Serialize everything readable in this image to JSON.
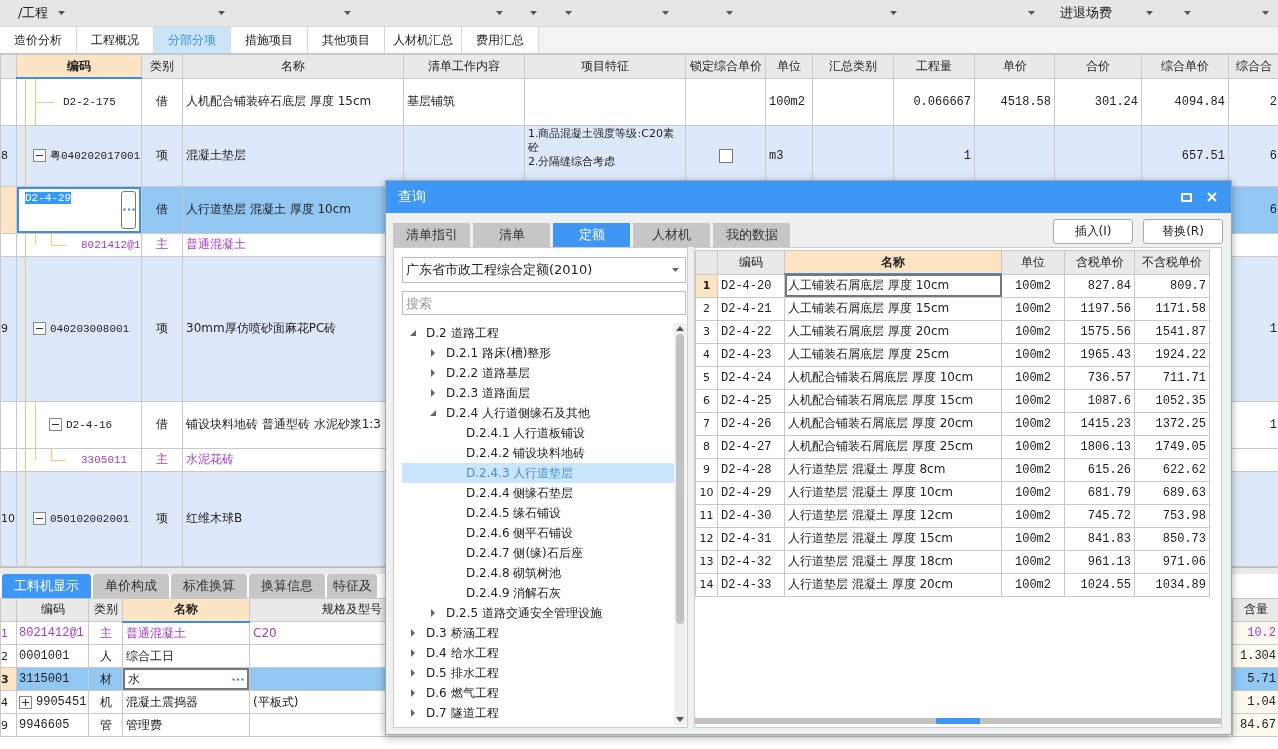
{
  "toolbar": {
    "items": [
      {
        "label": "/工程"
      },
      {
        "label": "进退场费"
      }
    ]
  },
  "tabs": [
    {
      "label": "造价分析",
      "selected": false
    },
    {
      "label": "工程概况",
      "selected": false
    },
    {
      "label": "分部分项",
      "selected": true
    },
    {
      "label": "措施项目",
      "selected": false
    },
    {
      "label": "其他项目",
      "selected": false
    },
    {
      "label": "人材机汇总",
      "selected": false
    },
    {
      "label": "费用汇总",
      "selected": false
    }
  ],
  "grid": {
    "columns": [
      {
        "label": "编码",
        "selected": true
      },
      {
        "label": "类别",
        "selected": false
      },
      {
        "label": "名称",
        "selected": false
      },
      {
        "label": "清单工作内容",
        "selected": false
      },
      {
        "label": "项目特征",
        "selected": false
      },
      {
        "label": "锁定综合单价",
        "selected": false
      },
      {
        "label": "单位",
        "selected": false
      },
      {
        "label": "汇总类别",
        "selected": false
      },
      {
        "label": "工程量",
        "selected": false
      },
      {
        "label": "单价",
        "selected": false
      },
      {
        "label": "合价",
        "selected": false
      },
      {
        "label": "综合单价",
        "selected": false
      },
      {
        "label": "综合合",
        "selected": false
      }
    ],
    "rows": [
      {
        "kind": "quota",
        "code": "D2-2-175",
        "type": "借",
        "name": "人机配合铺装碎石底层 厚度 15cm",
        "work": "基层铺筑",
        "unit": "100m2",
        "qty": "0.066667",
        "price": "4518.58",
        "total": "301.24",
        "unit_price": "4094.84",
        "col_14": "2",
        "selected": false,
        "editing": false
      },
      {
        "kind": "list",
        "num": "8",
        "code": "粤040202017001",
        "type": "项",
        "name": "混凝土垫层",
        "features": [
          "1.商品混凝土强度等级:C20素砼",
          "2.分隔缝综合考虑"
        ],
        "lock_checked": false,
        "unit": "m3",
        "qty": "1",
        "unit_price": "657.51",
        "col_14": "6",
        "selected": false,
        "editing": false,
        "expanded": true,
        "children": [
          {
            "kind": "quota",
            "code": "D2-4-29",
            "type": "借",
            "name": "人行道垫层 混凝土 厚度 10cm",
            "col_14": "6",
            "selected": true,
            "editing": true,
            "children": [
              {
                "kind": "material",
                "code": "8021412@1",
                "type": "主",
                "name": "普通混凝土",
                "selected": false,
                "editing": false
              }
            ]
          }
        ]
      },
      {
        "kind": "list",
        "num": "9",
        "code": "040203008001",
        "type": "项",
        "name": "30mm厚仿喷砂面麻花PC砖",
        "col_14": "1",
        "selected": false,
        "editing": false,
        "expanded": true,
        "children": [
          {
            "kind": "quota",
            "code": "D2-4-16",
            "type": "借",
            "name": "铺设块料地砖 普通型砖 水泥砂浆1:3",
            "col_14": "1",
            "selected": false,
            "editing": false,
            "expanded": true,
            "children": [
              {
                "kind": "material",
                "code": "3305011",
                "type": "主",
                "name": "水泥花砖",
                "selected": false,
                "editing": false
              }
            ]
          }
        ]
      },
      {
        "kind": "list",
        "num": "10",
        "code": "050102002001",
        "type": "项",
        "name": "红维木球B",
        "selected": false,
        "editing": false,
        "expanded": true
      }
    ]
  },
  "detail_tabs": [
    {
      "label": "工料机显示",
      "selected": true
    },
    {
      "label": "单价构成",
      "selected": false
    },
    {
      "label": "标准换算",
      "selected": false
    },
    {
      "label": "换算信息",
      "selected": false
    },
    {
      "label": "特征及",
      "selected": false
    }
  ],
  "detail_table": {
    "columns": [
      {
        "label": "编码",
        "selected": false
      },
      {
        "label": "类别",
        "selected": false
      },
      {
        "label": "名称",
        "selected": true
      },
      {
        "label": "规格及型号",
        "selected": false
      },
      {
        "label": "含量",
        "selected": false
      }
    ],
    "rows": [
      {
        "num": "1",
        "kind": "material",
        "code": "8021412@1",
        "type": "主",
        "name": "普通混凝土",
        "spec": "C20",
        "amount": "10.2",
        "selected": false,
        "editing": false
      },
      {
        "num": "2",
        "kind": "labor",
        "code": "0001001",
        "type": "人",
        "name": "综合工日",
        "amount": "1.304",
        "selected": false,
        "editing": false
      },
      {
        "num": "3",
        "kind": "labor",
        "code": "3115001",
        "type": "材",
        "name": "水",
        "amount": "5.71",
        "selected": true,
        "editing": true
      },
      {
        "num": "4",
        "kind": "labor",
        "code": "9905451",
        "type": "机",
        "name": "混凝土震捣器",
        "spec": "(平板式)",
        "amount": "1.04",
        "selected": false,
        "editing": false,
        "expanded": false
      },
      {
        "num": "9",
        "kind": "labor",
        "code": "9946605",
        "type": "管",
        "name": "管理费",
        "amount": "84.67",
        "selected": false,
        "editing": false
      }
    ]
  },
  "dialog": {
    "title": "查询",
    "tabs": [
      {
        "label": "清单指引",
        "selected": false
      },
      {
        "label": "清单",
        "selected": false
      },
      {
        "label": "定额",
        "selected": true
      },
      {
        "label": "人材机",
        "selected": false
      },
      {
        "label": "我的数据",
        "selected": false
      }
    ],
    "buttons": [
      "插入(I)",
      "替换(R)"
    ],
    "library": "广东省市政工程综合定额(2010)",
    "search_placeholder": "搜索",
    "tree": [
      {
        "label": "D.2 道路工程",
        "expanded": true,
        "selected": false,
        "children": [
          {
            "label": "D.2.1 路床(槽)整形",
            "expanded": false,
            "selected": false
          },
          {
            "label": "D.2.2 道路基层",
            "expanded": false,
            "selected": false
          },
          {
            "label": "D.2.3 道路面层",
            "expanded": false,
            "selected": false
          },
          {
            "label": "D.2.4 人行道侧缘石及其他",
            "expanded": true,
            "selected": false,
            "children": [
              {
                "label": "D.2.4.1 人行道板铺设",
                "selected": false
              },
              {
                "label": "D.2.4.2 铺设块料地砖",
                "selected": false
              },
              {
                "label": "D.2.4.3 人行道垫层",
                "selected": true
              },
              {
                "label": "D.2.4.4 侧缘石垫层",
                "selected": false
              },
              {
                "label": "D.2.4.5 缘石铺设",
                "selected": false
              },
              {
                "label": "D.2.4.6 侧平石铺设",
                "selected": false
              },
              {
                "label": "D.2.4.7 侧(缘)石后座",
                "selected": false
              },
              {
                "label": "D.2.4.8 砌筑树池",
                "selected": false
              },
              {
                "label": "D.2.4.9 消解石灰",
                "selected": false
              }
            ]
          },
          {
            "label": "D.2.5 道路交通安全管理设施",
            "expanded": false,
            "selected": false
          }
        ]
      },
      {
        "label": "D.3 桥涵工程",
        "expanded": false,
        "selected": false
      },
      {
        "label": "D.4 给水工程",
        "expanded": false,
        "selected": false
      },
      {
        "label": "D.5 排水工程",
        "expanded": false,
        "selected": false
      },
      {
        "label": "D.6 燃气工程",
        "expanded": false,
        "selected": false
      },
      {
        "label": "D.7 隧道工程",
        "expanded": false,
        "selected": false
      }
    ],
    "table": {
      "columns": [
        {
          "label": "编码",
          "selected": false
        },
        {
          "label": "名称",
          "selected": true
        },
        {
          "label": "单位",
          "selected": false
        },
        {
          "label": "含税单价",
          "selected": false
        },
        {
          "label": "不含税单价",
          "selected": false
        }
      ],
      "rows": [
        {
          "num": "1",
          "code": "D2-4-20",
          "name": "人工铺装石屑底层 厚度 10cm",
          "unit": "100m2",
          "price_tax": "827.84",
          "price_notax": "809.7",
          "selected": true
        },
        {
          "num": "2",
          "code": "D2-4-21",
          "name": "人工铺装石屑底层 厚度 15cm",
          "unit": "100m2",
          "price_tax": "1197.56",
          "price_notax": "1171.58",
          "selected": false
        },
        {
          "num": "3",
          "code": "D2-4-22",
          "name": "人工铺装石屑底层 厚度 20cm",
          "unit": "100m2",
          "price_tax": "1575.56",
          "price_notax": "1541.87",
          "selected": false
        },
        {
          "num": "4",
          "code": "D2-4-23",
          "name": "人工铺装石屑底层 厚度 25cm",
          "unit": "100m2",
          "price_tax": "1965.43",
          "price_notax": "1924.22",
          "selected": false
        },
        {
          "num": "5",
          "code": "D2-4-24",
          "name": "人机配合铺装石屑底层 厚度 10cm",
          "unit": "100m2",
          "price_tax": "736.57",
          "price_notax": "711.71",
          "selected": false
        },
        {
          "num": "6",
          "code": "D2-4-25",
          "name": "人机配合铺装石屑底层 厚度 15cm",
          "unit": "100m2",
          "price_tax": "1087.6",
          "price_notax": "1052.35",
          "selected": false
        },
        {
          "num": "7",
          "code": "D2-4-26",
          "name": "人机配合铺装石屑底层 厚度 20cm",
          "unit": "100m2",
          "price_tax": "1415.23",
          "price_notax": "1372.25",
          "selected": false
        },
        {
          "num": "8",
          "code": "D2-4-27",
          "name": "人机配合铺装石屑底层 厚度 25cm",
          "unit": "100m2",
          "price_tax": "1806.13",
          "price_notax": "1749.05",
          "selected": false
        },
        {
          "num": "9",
          "code": "D2-4-28",
          "name": "人行道垫层 混凝土 厚度 8cm",
          "unit": "100m2",
          "price_tax": "615.26",
          "price_notax": "622.62",
          "selected": false
        },
        {
          "num": "10",
          "code": "D2-4-29",
          "name": "人行道垫层 混凝土 厚度 10cm",
          "unit": "100m2",
          "price_tax": "681.79",
          "price_notax": "689.63",
          "selected": false
        },
        {
          "num": "11",
          "code": "D2-4-30",
          "name": "人行道垫层 混凝土 厚度 12cm",
          "unit": "100m2",
          "price_tax": "745.72",
          "price_notax": "753.98",
          "selected": false
        },
        {
          "num": "12",
          "code": "D2-4-31",
          "name": "人行道垫层 混凝土 厚度 15cm",
          "unit": "100m2",
          "price_tax": "841.83",
          "price_notax": "850.73",
          "selected": false
        },
        {
          "num": "13",
          "code": "D2-4-32",
          "name": "人行道垫层 混凝土 厚度 18cm",
          "unit": "100m2",
          "price_tax": "961.13",
          "price_notax": "971.06",
          "selected": false
        },
        {
          "num": "14",
          "code": "D2-4-33",
          "name": "人行道垫层 混凝土 厚度 20cm",
          "unit": "100m2",
          "price_tax": "1024.55",
          "price_notax": "1034.89",
          "selected": false
        }
      ]
    }
  }
}
